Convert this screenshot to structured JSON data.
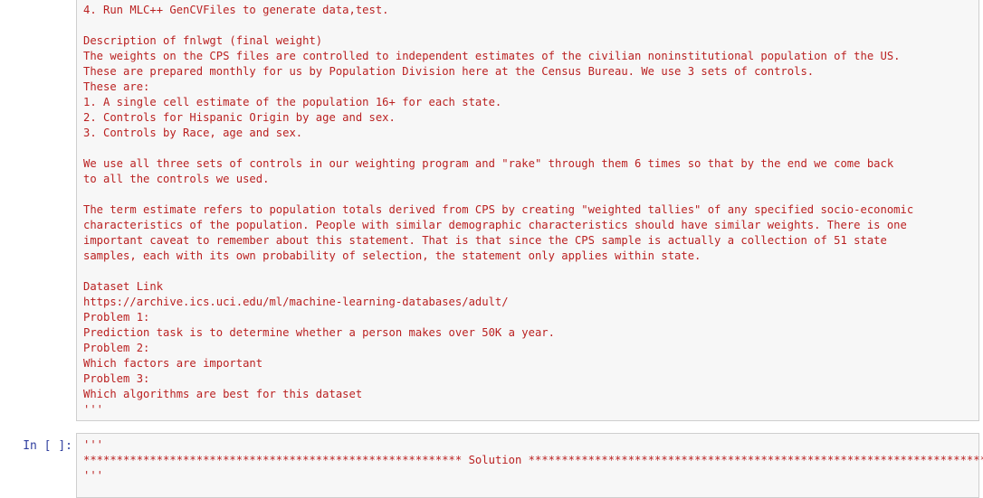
{
  "cell1": {
    "lines": [
      "4. Run MLC++ GenCVFiles to generate data,test.",
      "",
      "Description of fnlwgt (final weight)",
      "The weights on the CPS files are controlled to independent estimates of the civilian noninstitutional population of the US.",
      "These are prepared monthly for us by Population Division here at the Census Bureau. We use 3 sets of controls.",
      "These are:",
      "1. A single cell estimate of the population 16+ for each state.",
      "2. Controls for Hispanic Origin by age and sex.",
      "3. Controls by Race, age and sex.",
      "",
      "We use all three sets of controls in our weighting program and \"rake\" through them 6 times so that by the end we come back",
      "to all the controls we used.",
      "",
      "The term estimate refers to population totals derived from CPS by creating \"weighted tallies\" of any specified socio-economic",
      "characteristics of the population. People with similar demographic characteristics should have similar weights. There is one",
      "important caveat to remember about this statement. That is that since the CPS sample is actually a collection of 51 state",
      "samples, each with its own probability of selection, the statement only applies within state.",
      "",
      "Dataset Link",
      "https://archive.ics.uci.edu/ml/machine-learning-databases/adult/",
      "Problem 1:",
      "Prediction task is to determine whether a person makes over 50K a year.",
      "Problem 2:",
      "Which factors are important",
      "Problem 3:",
      "Which algorithms are best for this dataset",
      "'''"
    ]
  },
  "cell2": {
    "prompt": "In [ ]:",
    "open_quote": "'''",
    "stars_left": "*********************************************************",
    "solution_label": "Solution",
    "stars_right": "***************************************************************************",
    "close_quote": "'''"
  }
}
